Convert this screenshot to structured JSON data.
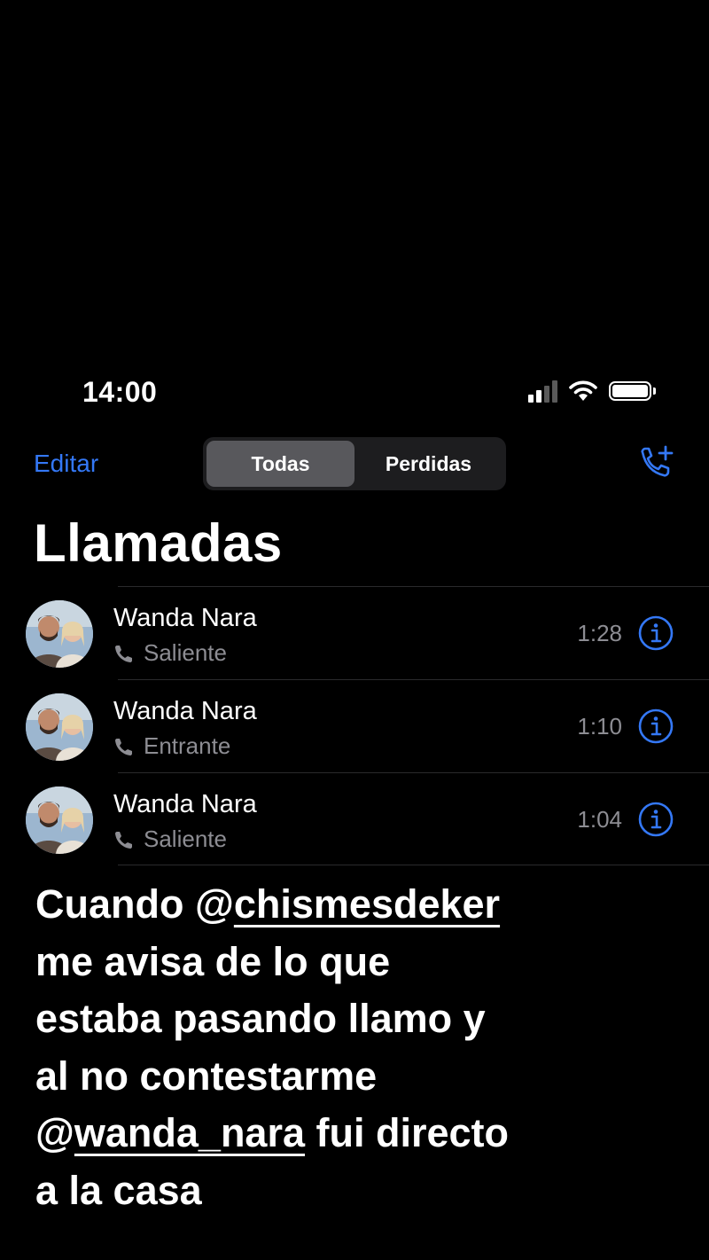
{
  "status_bar": {
    "time": "14:00",
    "signal_icon": "signal-bars-icon",
    "wifi_icon": "wifi-icon",
    "battery_icon": "battery-icon"
  },
  "nav": {
    "edit_label": "Editar",
    "segments": [
      {
        "label": "Todas",
        "selected": true
      },
      {
        "label": "Perdidas",
        "selected": false
      }
    ],
    "new_call_icon": "phone-plus-icon"
  },
  "title": "Llamadas",
  "calls": [
    {
      "name": "Wanda Nara",
      "type": "Saliente",
      "time": "1:28"
    },
    {
      "name": "Wanda Nara",
      "type": "Entrante",
      "time": "1:10"
    },
    {
      "name": "Wanda Nara",
      "type": "Saliente",
      "time": "1:04"
    }
  ],
  "story_text": {
    "line1_prefix": "Cuando @",
    "line1_mention": "chismesdeker",
    "line2": "me avisa de lo que",
    "line3": "estaba pasando llamo y",
    "line4": "al no contestarme",
    "line5_prefix": "@",
    "line5_mention": "wanda_nara",
    "line5_suffix": " fui directo",
    "line6": "a la casa"
  },
  "colors": {
    "accent": "#3478f6",
    "secondary_text": "#8d8d93",
    "background": "#000000"
  }
}
